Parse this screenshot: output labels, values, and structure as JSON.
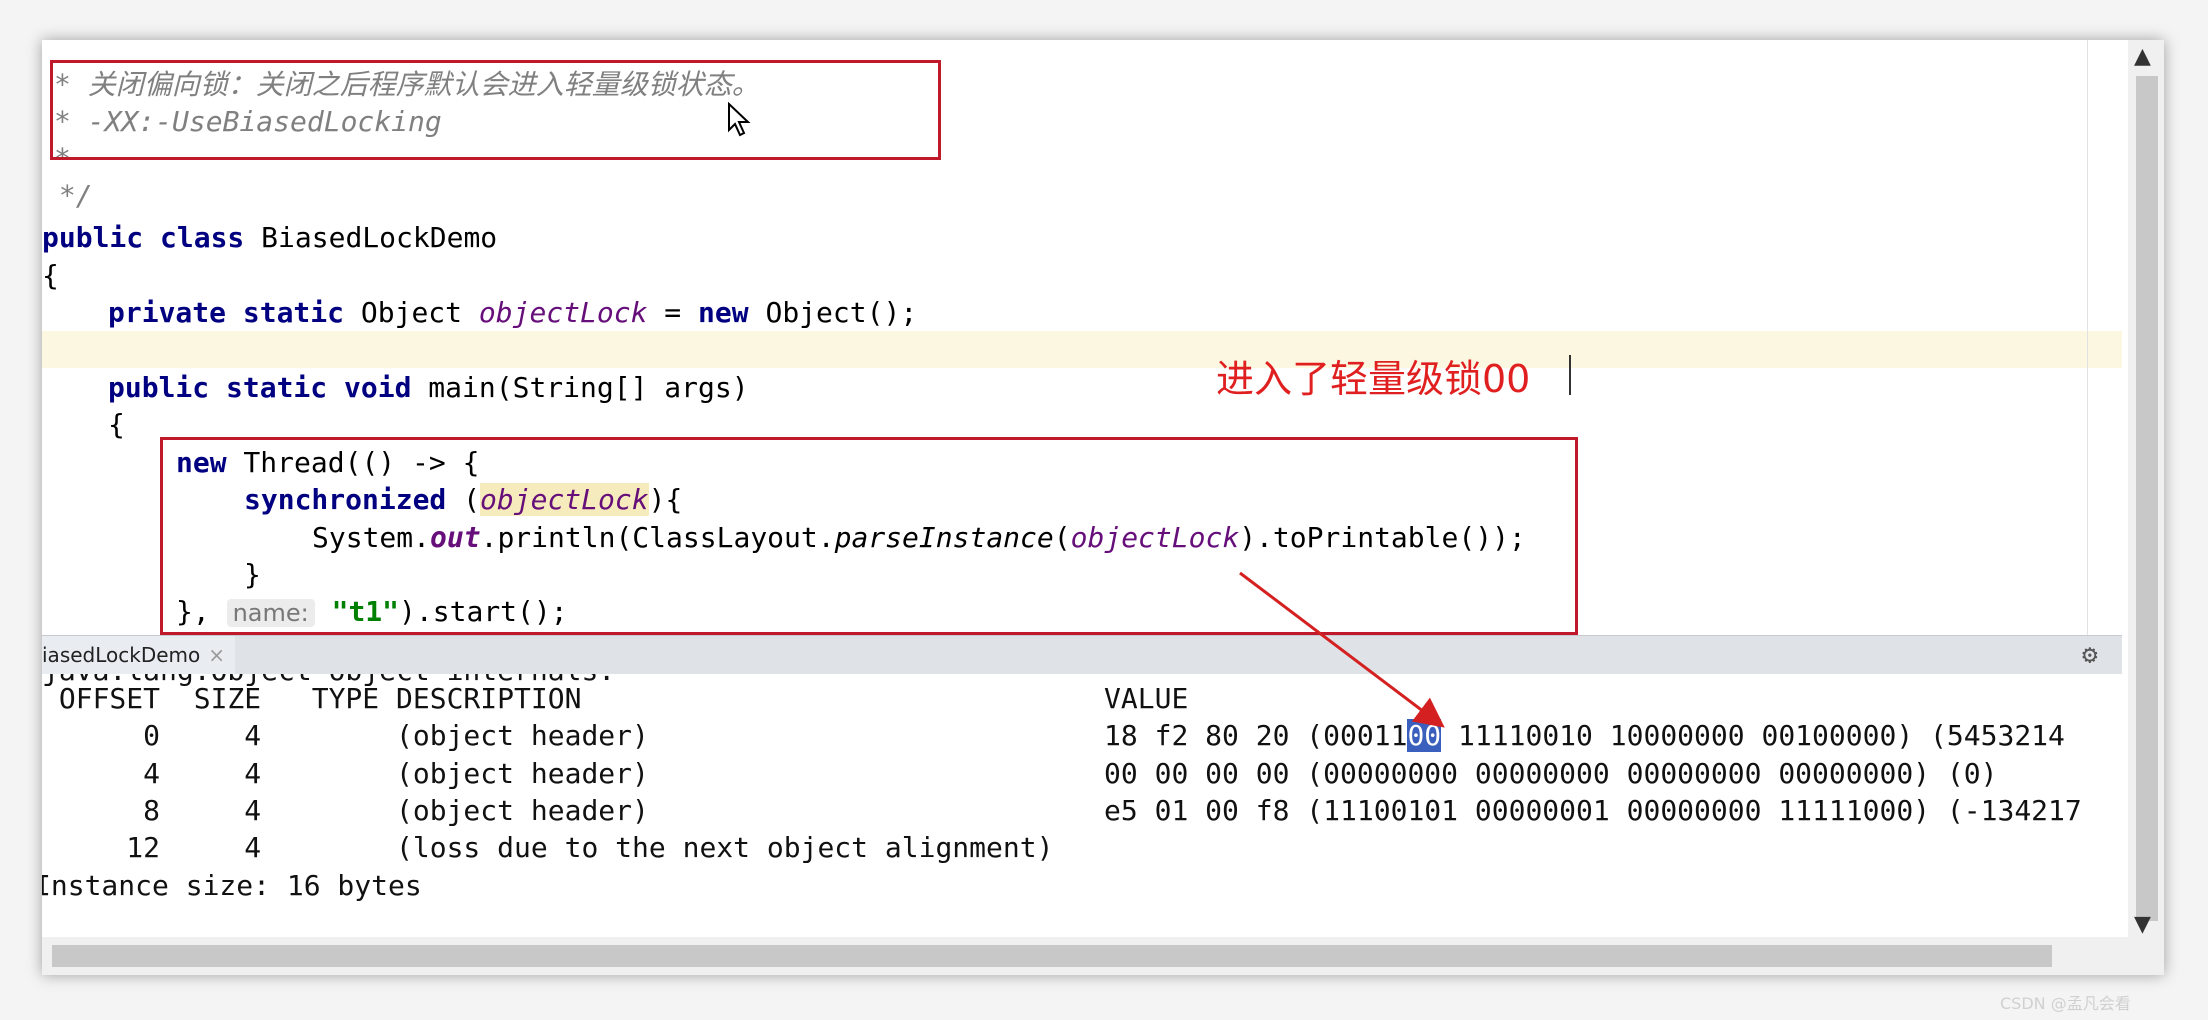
{
  "editor": {
    "lines": {
      "c1": "* 关闭偏向锁：关闭之后程序默认会进入轻量级锁状态。",
      "c2": "* -XX:-UseBiasedLocking",
      "c3": "*",
      "c4": " */",
      "l1_kw": "public class",
      "l1_name": " BiasedLockDemo",
      "l2": "{",
      "l3_kw": "private static",
      "l3_type": " Object ",
      "l3_var": "objectLock",
      "l3_eq": " = ",
      "l3_new": "new",
      "l3_rest": " Object();",
      "l5_kw": "public static void",
      "l5_rest": " main(String[] args)",
      "l6": "{",
      "l7_new": "new",
      "l7_rest": " Thread(() -> {",
      "l8_kw": "synchronized",
      "l8_open": " (",
      "l8_var": "objectLock",
      "l8_close": "){",
      "l9_a": "System.",
      "l9_out": "out",
      "l9_b": ".println(ClassLayout.",
      "l9_parse": "parseInstance",
      "l9_c": "(",
      "l9_var": "objectLock",
      "l9_d": ").toPrintable());",
      "l10": "}",
      "l11_a": "}, ",
      "l11_hint": "name:",
      "l11_str": "\"t1\"",
      "l11_b": ").start();"
    },
    "annotation": "进入了轻量级锁00"
  },
  "tab": {
    "label": "iasedLockDemo",
    "close": "×"
  },
  "console": {
    "partial_top": "java.lang.Object object internals:",
    "header": " OFFSET  SIZE   TYPE DESCRIPTION                               VALUE",
    "row0_a": "      0     4        (object header)                           18 f2 80 20 (00011",
    "row0_sel": "00",
    "row0_b": " 11110010 10000000 00100000) (5453214",
    "row1": "      4     4        (object header)                           00 00 00 00 (00000000 00000000 00000000 00000000) (0)",
    "row2": "      8     4        (object header)                           e5 01 00 f8 (11100101 00000001 00000000 11111000) (-134217",
    "row3": "     12     4        (loss due to the next object alignment)",
    "size": "Instance size: 16 bytes"
  },
  "watermark": "CSDN @孟凡会看",
  "colors": {
    "red_box": "#c0192b",
    "annotation": "#e02020",
    "keyword": "#000080",
    "selection": "#3a5fbd"
  }
}
